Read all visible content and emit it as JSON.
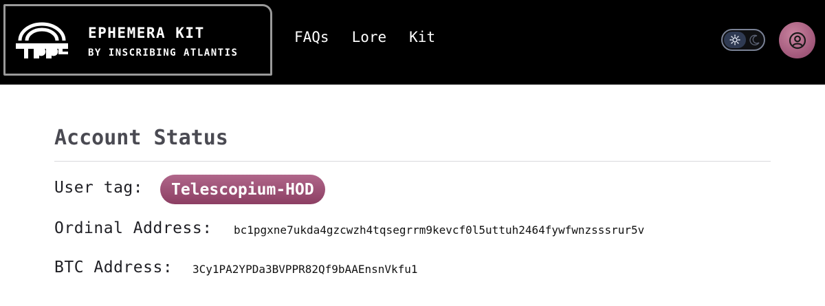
{
  "header": {
    "brand_title": "EPHEMERA KIT",
    "brand_subtitle": "BY INSCRIBING ATLANTIS",
    "logo_icon": "ephemera-arch-logo",
    "nav": [
      "FAQs",
      "Lore",
      "Kit"
    ],
    "theme_toggle": {
      "selected": "light",
      "icons": [
        "sun-icon",
        "moon-icon"
      ]
    },
    "avatar_icon": "user-circle-icon",
    "colors": {
      "background": "#000000",
      "border": "#9a9a9a",
      "avatar": "#a35a7c"
    }
  },
  "account": {
    "title": "Account Status",
    "user_tag_label": "User tag:",
    "user_tag_value": "Telescopium-HOD",
    "ordinal_label": "Ordinal Address:",
    "ordinal_value": "bc1pgxne7ukda4gzcwzh4tqsegrrm9kevcf0l5uttuh2464fywfwnzsssrur5v",
    "btc_label": "BTC Address:",
    "btc_value": "3Cy1PA2YPDa3BVPPR82Qf9bAAEnsnVkfu1",
    "tag_color": "#9c4f73"
  }
}
